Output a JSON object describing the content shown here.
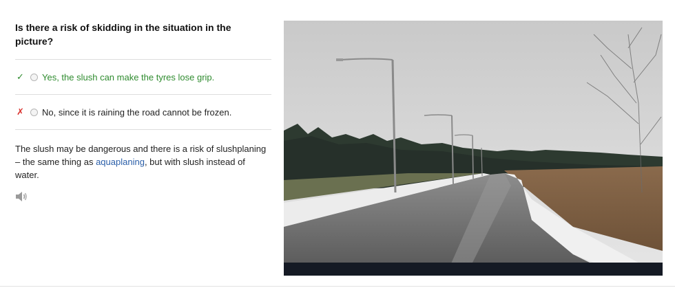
{
  "question": {
    "text": "Is there a risk of skidding in the situation in the picture?"
  },
  "answers": [
    {
      "mark": "✓",
      "mark_icon": "check-icon",
      "text": "Yes, the slush can make the tyres lose grip.",
      "status": "correct"
    },
    {
      "mark": "✗",
      "mark_icon": "cross-icon",
      "text": "No, since it is raining the road cannot be frozen.",
      "status": "incorrect"
    }
  ],
  "explanation": {
    "before_link": "The slush may be dangerous and there is a risk of slushplaning – the same thing as ",
    "link_text": "aquaplaning",
    "after_link": ", but with slush instead of water."
  },
  "audio": {
    "icon": "speaker-icon"
  },
  "colors": {
    "correct": "#2e8b2e",
    "incorrect": "#d9302c",
    "link": "#2a5ea8"
  }
}
